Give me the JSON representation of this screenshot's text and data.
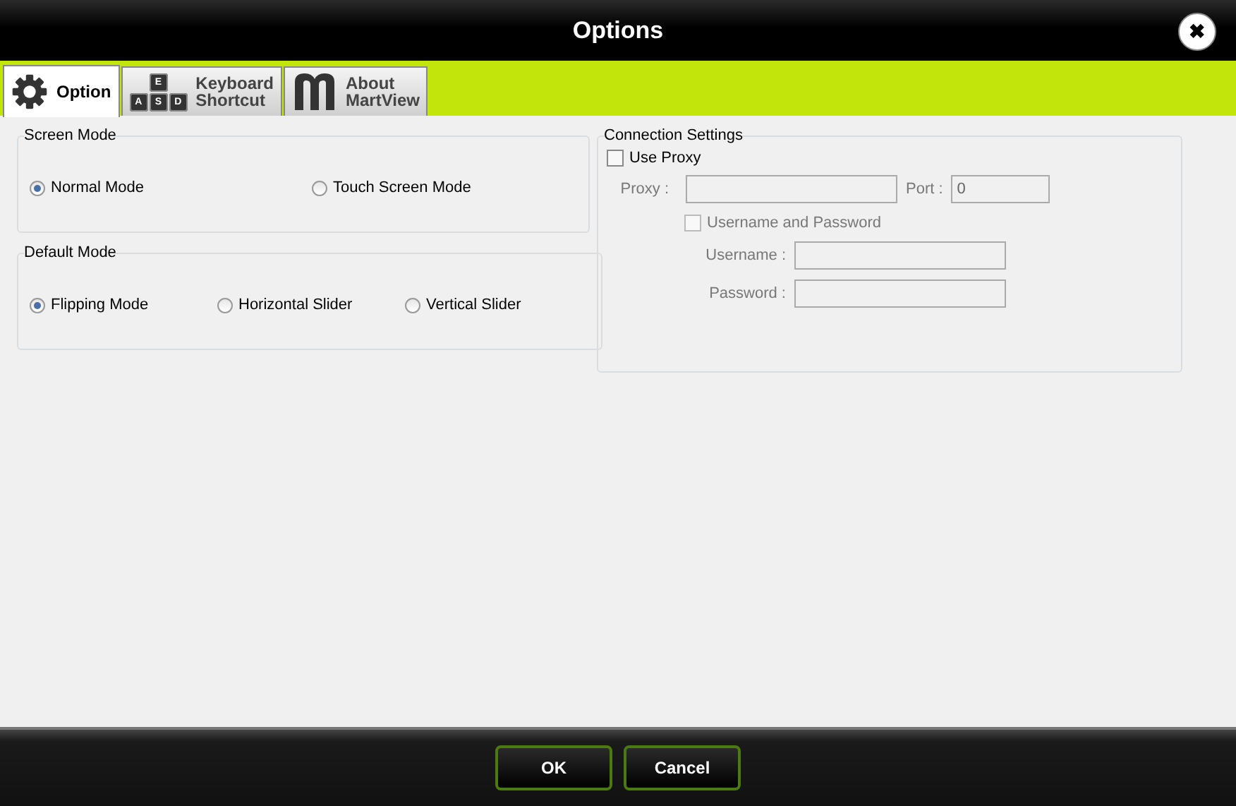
{
  "window": {
    "title": "Options",
    "close": "✖"
  },
  "tabs": [
    {
      "label": "Option",
      "kind": "gear",
      "selected": true
    },
    {
      "label": "Keyboard\nShortcut",
      "kind": "keys",
      "keys": [
        "E",
        "A",
        "S",
        "D"
      ],
      "selected": false
    },
    {
      "label": "About\nMartView",
      "kind": "logo",
      "selected": false
    }
  ],
  "groups": [
    {
      "title": "Screen Mode",
      "options": [
        {
          "label": "Normal Mode",
          "selected": true
        },
        {
          "label": "Touch Screen Mode",
          "selected": false
        }
      ]
    },
    {
      "title": "Default Mode",
      "options": [
        {
          "label": "Flipping Mode",
          "selected": true
        },
        {
          "label": "Horizontal Slider",
          "selected": false
        },
        {
          "label": "Vertical Slider",
          "selected": false
        }
      ]
    }
  ],
  "connection": {
    "title": "Connection Settings",
    "use_proxy": {
      "label": "Use Proxy",
      "checked": false,
      "disabled": false
    },
    "proxy": {
      "label": "Proxy :",
      "disabled": true
    },
    "port": {
      "label": "Port :",
      "value": "0",
      "disabled": true
    },
    "credentials": {
      "label": "Username and Password",
      "checked": false,
      "disabled": true
    },
    "username": {
      "label": "Username :",
      "disabled": true
    },
    "password": {
      "label": "Password :",
      "disabled": true
    }
  },
  "buttons": [
    "OK",
    "Cancel"
  ]
}
